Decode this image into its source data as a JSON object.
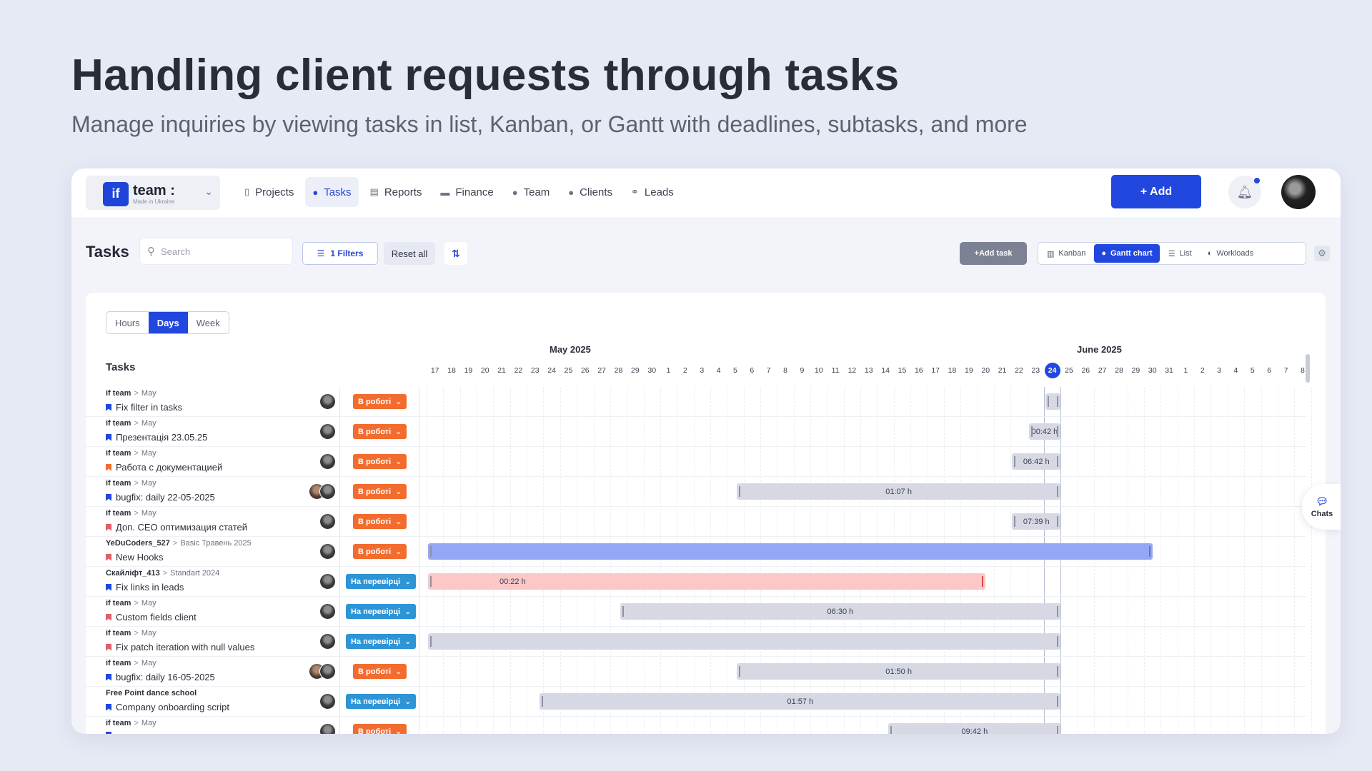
{
  "hero": {
    "title": "Handling client requests through tasks",
    "subtitle": "Manage inquiries by viewing tasks in list, Kanban, or Gantt  with deadlines, subtasks, and more"
  },
  "brand": {
    "logo": "if",
    "name": "team :",
    "tagline": "Made in Ukraine"
  },
  "nav": [
    "Projects",
    "Tasks",
    "Reports",
    "Finance",
    "Team",
    "Clients",
    "Leads"
  ],
  "nav_active": "Tasks",
  "topbar": {
    "add_label": "+ Add"
  },
  "toolbar": {
    "title": "Tasks",
    "search_placeholder": "Search",
    "filters_label": "1   Filters",
    "reset_label": "Reset all",
    "add_task_label": "Add task"
  },
  "views": [
    "Kanban",
    "Gantt chart",
    "List",
    "Workloads"
  ],
  "views_active": "Gantt chart",
  "scale": [
    "Hours",
    "Days",
    "Week"
  ],
  "scale_active": "Days",
  "gantt": {
    "column_header": "Tasks",
    "months": [
      "May 2025",
      "June 2025"
    ],
    "days": [
      "17",
      "18",
      "19",
      "20",
      "21",
      "22",
      "23",
      "24",
      "25",
      "26",
      "27",
      "28",
      "29",
      "30",
      "1",
      "2",
      "3",
      "4",
      "5",
      "6",
      "7",
      "8",
      "9",
      "10",
      "11",
      "12",
      "13",
      "14",
      "15",
      "16",
      "17",
      "18",
      "19",
      "20",
      "21",
      "22",
      "23",
      "24",
      "25",
      "26",
      "27",
      "28",
      "29",
      "30",
      "31",
      "1",
      "2",
      "3",
      "4",
      "5",
      "6",
      "7",
      "8"
    ],
    "today": "24",
    "tasks": [
      {
        "project": "if team",
        "sub": "May",
        "name": "Fix filter in tasks",
        "flag": "#2147df",
        "status": "В роботі",
        "bar_label": ""
      },
      {
        "project": "if team",
        "sub": "May",
        "name": "Презентація 23.05.25",
        "flag": "#2147df",
        "status": "В роботі",
        "bar_label": "00:42 h"
      },
      {
        "project": "if team",
        "sub": "May",
        "name": "Работа с документацией",
        "flag": "#f36c2f",
        "status": "В роботі",
        "bar_label": "06:42 h"
      },
      {
        "project": "if team",
        "sub": "May",
        "name": "bugfix: daily 22-05-2025",
        "flag": "#2147df",
        "status": "В роботі",
        "bar_label": "01:07 h"
      },
      {
        "project": "if team",
        "sub": "May",
        "name": "Доп. СЕО оптимизация статей",
        "flag": "#e35d6a",
        "status": "В роботі",
        "bar_label": "07:39 h"
      },
      {
        "project": "YeDuCoders_527",
        "sub": "Basic Травень 2025",
        "name": "New Hooks",
        "flag": "#e35d6a",
        "status": "В роботі",
        "bar_label": ""
      },
      {
        "project": "Скайліфт_413",
        "sub": "Standart 2024",
        "name": "Fix links in leads",
        "flag": "#2147df",
        "status": "На перевірці",
        "bar_label": "00:22 h"
      },
      {
        "project": "if team",
        "sub": "May",
        "name": "Custom fields client",
        "flag": "#e35d6a",
        "status": "На перевірці",
        "bar_label": "06:30 h"
      },
      {
        "project": "if team",
        "sub": "May",
        "name": "Fix patch iteration with null values",
        "flag": "#e35d6a",
        "status": "На перевірці",
        "bar_label": ""
      },
      {
        "project": "if team",
        "sub": "May",
        "name": "bugfix: daily 16-05-2025",
        "flag": "#2147df",
        "status": "В роботі",
        "bar_label": "01:50 h"
      },
      {
        "project": "Free Point dance school",
        "sub": "",
        "name": "Company onboarding script",
        "flag": "#2147df",
        "status": "На перевірці",
        "bar_label": "01:57 h"
      },
      {
        "project": "if team",
        "sub": "May",
        "name": "",
        "flag": "#2147df",
        "status": "В роботі",
        "bar_label": "09:42 h"
      }
    ]
  },
  "chats_label": "Chats",
  "colors": {
    "accent": "#2147df",
    "in_progress": "#f36c2f",
    "in_review": "#2d94d6"
  }
}
